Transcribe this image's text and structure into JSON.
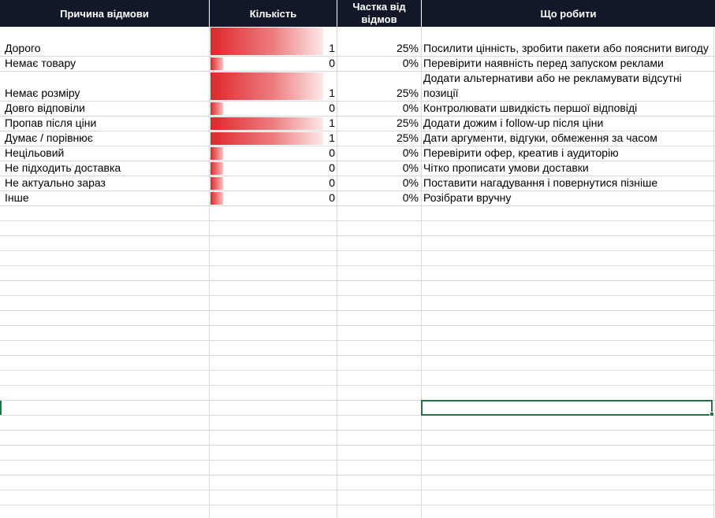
{
  "headers": {
    "reason": "Причина відмови",
    "count": "Кількість",
    "share": "Частка від відмов",
    "todo": "Що робити"
  },
  "rows": [
    {
      "reason": "Дорого",
      "count": "1",
      "share": "25%",
      "todo": "Посилити цінність, зробити пакети або пояснити вигоду",
      "count_value": 1
    },
    {
      "reason": "Немає товару",
      "count": "0",
      "share": "0%",
      "todo": "Перевірити наявність перед запуском реклами",
      "count_value": 0
    },
    {
      "reason": "Немає розміру",
      "count": "1",
      "share": "25%",
      "todo": "Додати альтернативи або не рекламувати відсутні позиції",
      "count_value": 1
    },
    {
      "reason": "Довго відповіли",
      "count": "0",
      "share": "0%",
      "todo": "Контролювати швидкість першої відповіді",
      "count_value": 0
    },
    {
      "reason": "Пропав після ціни",
      "count": "1",
      "share": "25%",
      "todo": "Додати дожим і follow-up після ціни",
      "count_value": 1
    },
    {
      "reason": "Думає / порівнює",
      "count": "1",
      "share": "25%",
      "todo": "Дати аргументи, відгуки, обмеження за часом",
      "count_value": 1
    },
    {
      "reason": "Нецільовий",
      "count": "0",
      "share": "0%",
      "todo": "Перевірити офер, креатив і аудиторію",
      "count_value": 0
    },
    {
      "reason": "Не підходить доставка",
      "count": "0",
      "share": "0%",
      "todo": "Чітко прописати умови доставки",
      "count_value": 0
    },
    {
      "reason": "Не актуально зараз",
      "count": "0",
      "share": "0%",
      "todo": "Поставити нагадування і повернутися пізніше",
      "count_value": 0
    },
    {
      "reason": "Інше",
      "count": "0",
      "share": "0%",
      "todo": "Розібрати вручну",
      "count_value": 0
    }
  ],
  "colors": {
    "header_bg": "#111827",
    "header_text": "#ffffff",
    "databar": "#e0262b",
    "selection": "#217346",
    "gridline": "#d9d9d9"
  }
}
